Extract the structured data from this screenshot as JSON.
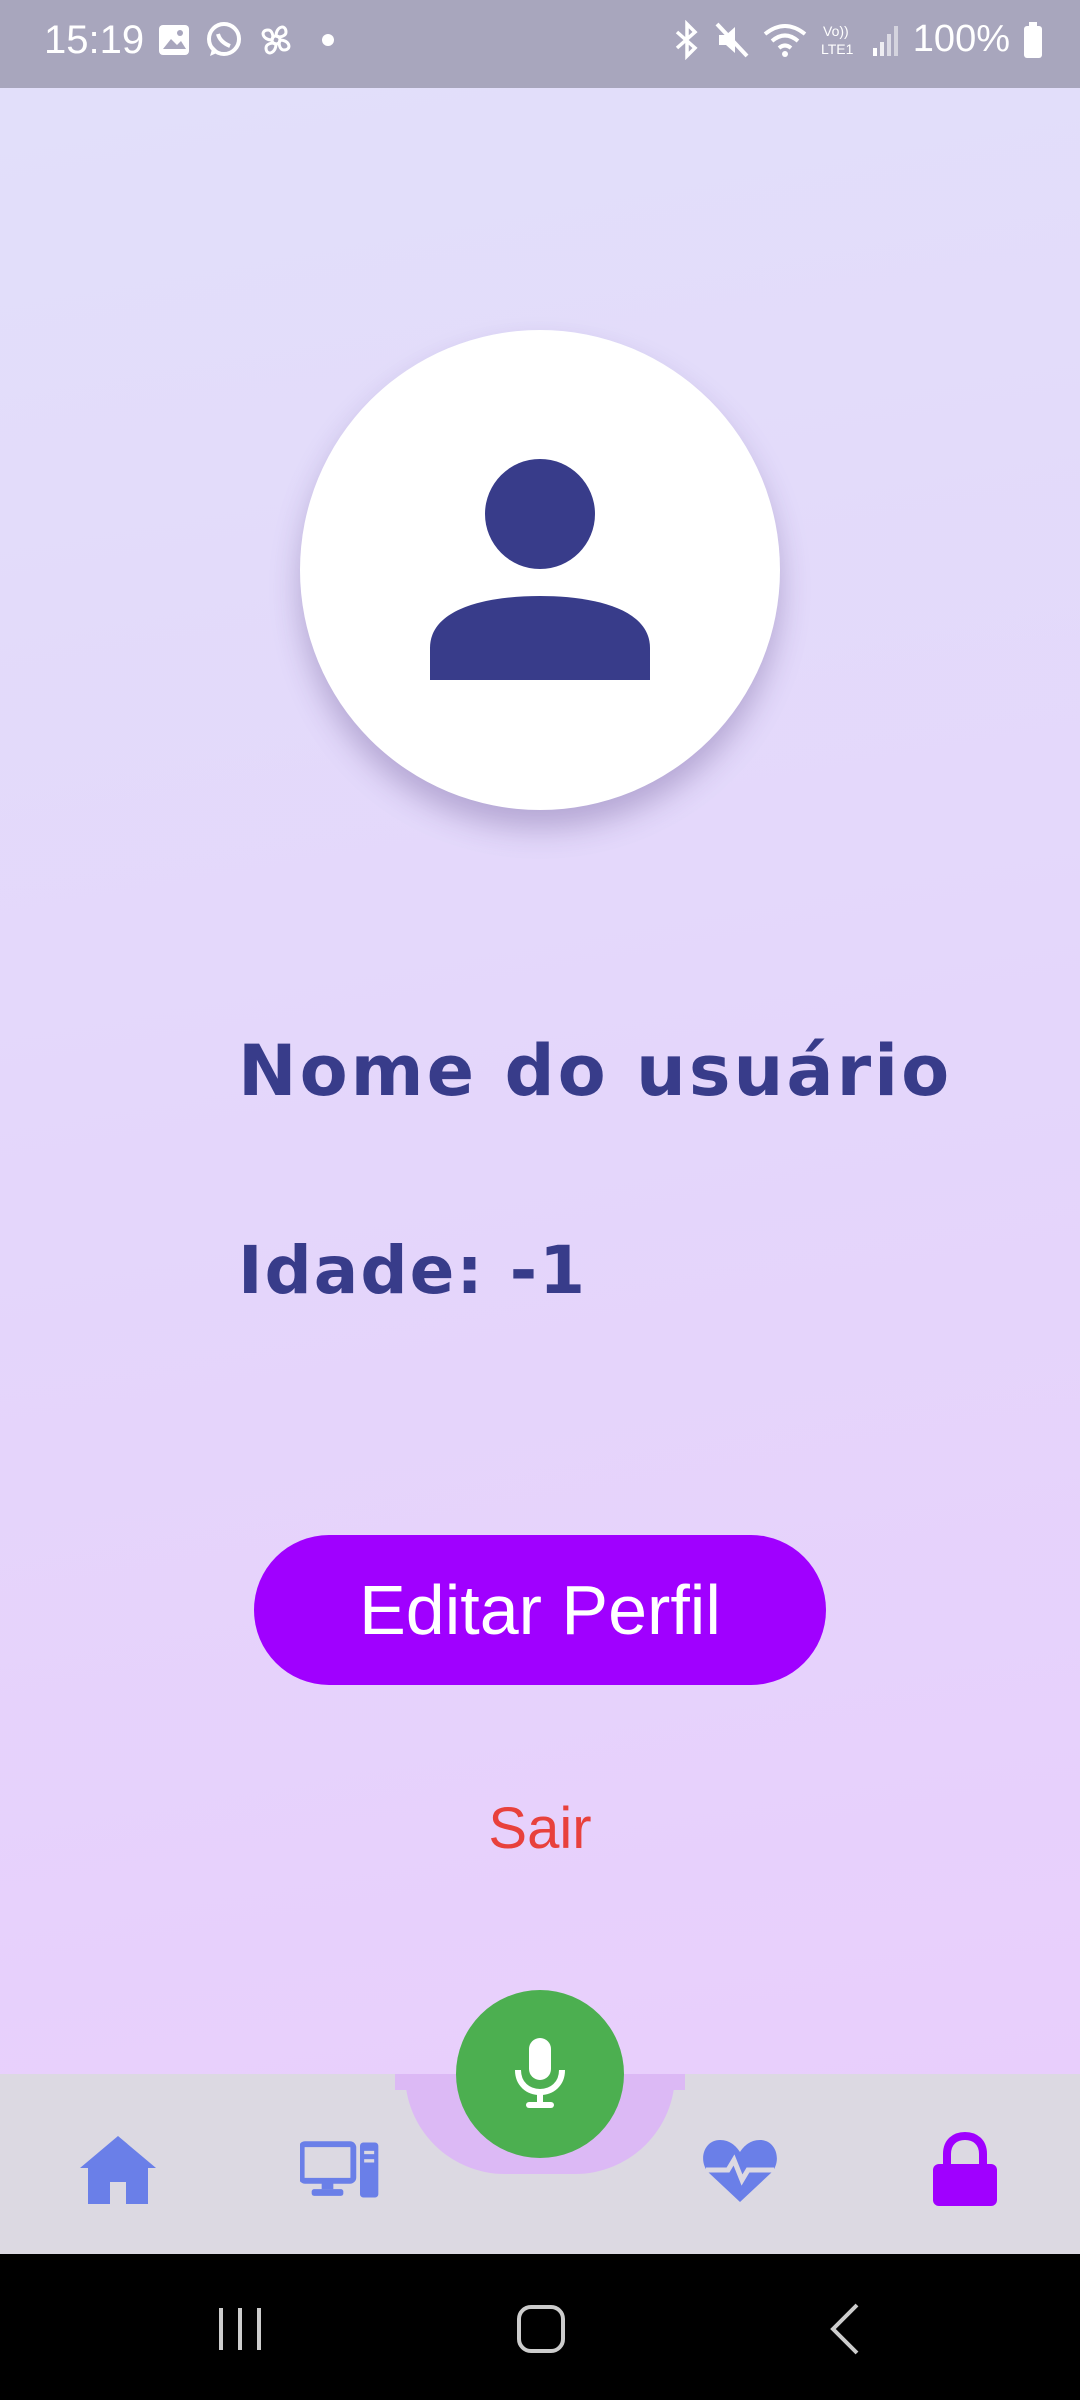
{
  "status_bar": {
    "time": "15:19",
    "battery": "100%",
    "left_icons": [
      "gallery-icon",
      "whatsapp-icon",
      "fan-icon",
      "dot-icon"
    ],
    "right_icons": [
      "bluetooth-icon",
      "mute-icon",
      "wifi-icon",
      "volte-icon",
      "signal-icon",
      "battery-icon"
    ],
    "network_label": "Vo))\nLTE1"
  },
  "profile": {
    "avatar_icon": "person-icon",
    "name": "Nome do usuário",
    "age": "Idade: -1"
  },
  "actions": {
    "edit_label": "Editar Perfil",
    "logout_label": "Sair"
  },
  "bottom_nav": {
    "items": [
      {
        "icon": "home-icon"
      },
      {
        "icon": "devices-icon"
      },
      {
        "icon": "microphone-icon"
      },
      {
        "icon": "heart-pulse-icon"
      },
      {
        "icon": "lock-icon"
      }
    ],
    "active": "lock-icon"
  },
  "colors": {
    "accent": "#a000ff",
    "text_primary": "#383c8a",
    "logout": "#e8413c",
    "mic": "#4caf50",
    "nav_icon": "#6a7fe8"
  }
}
